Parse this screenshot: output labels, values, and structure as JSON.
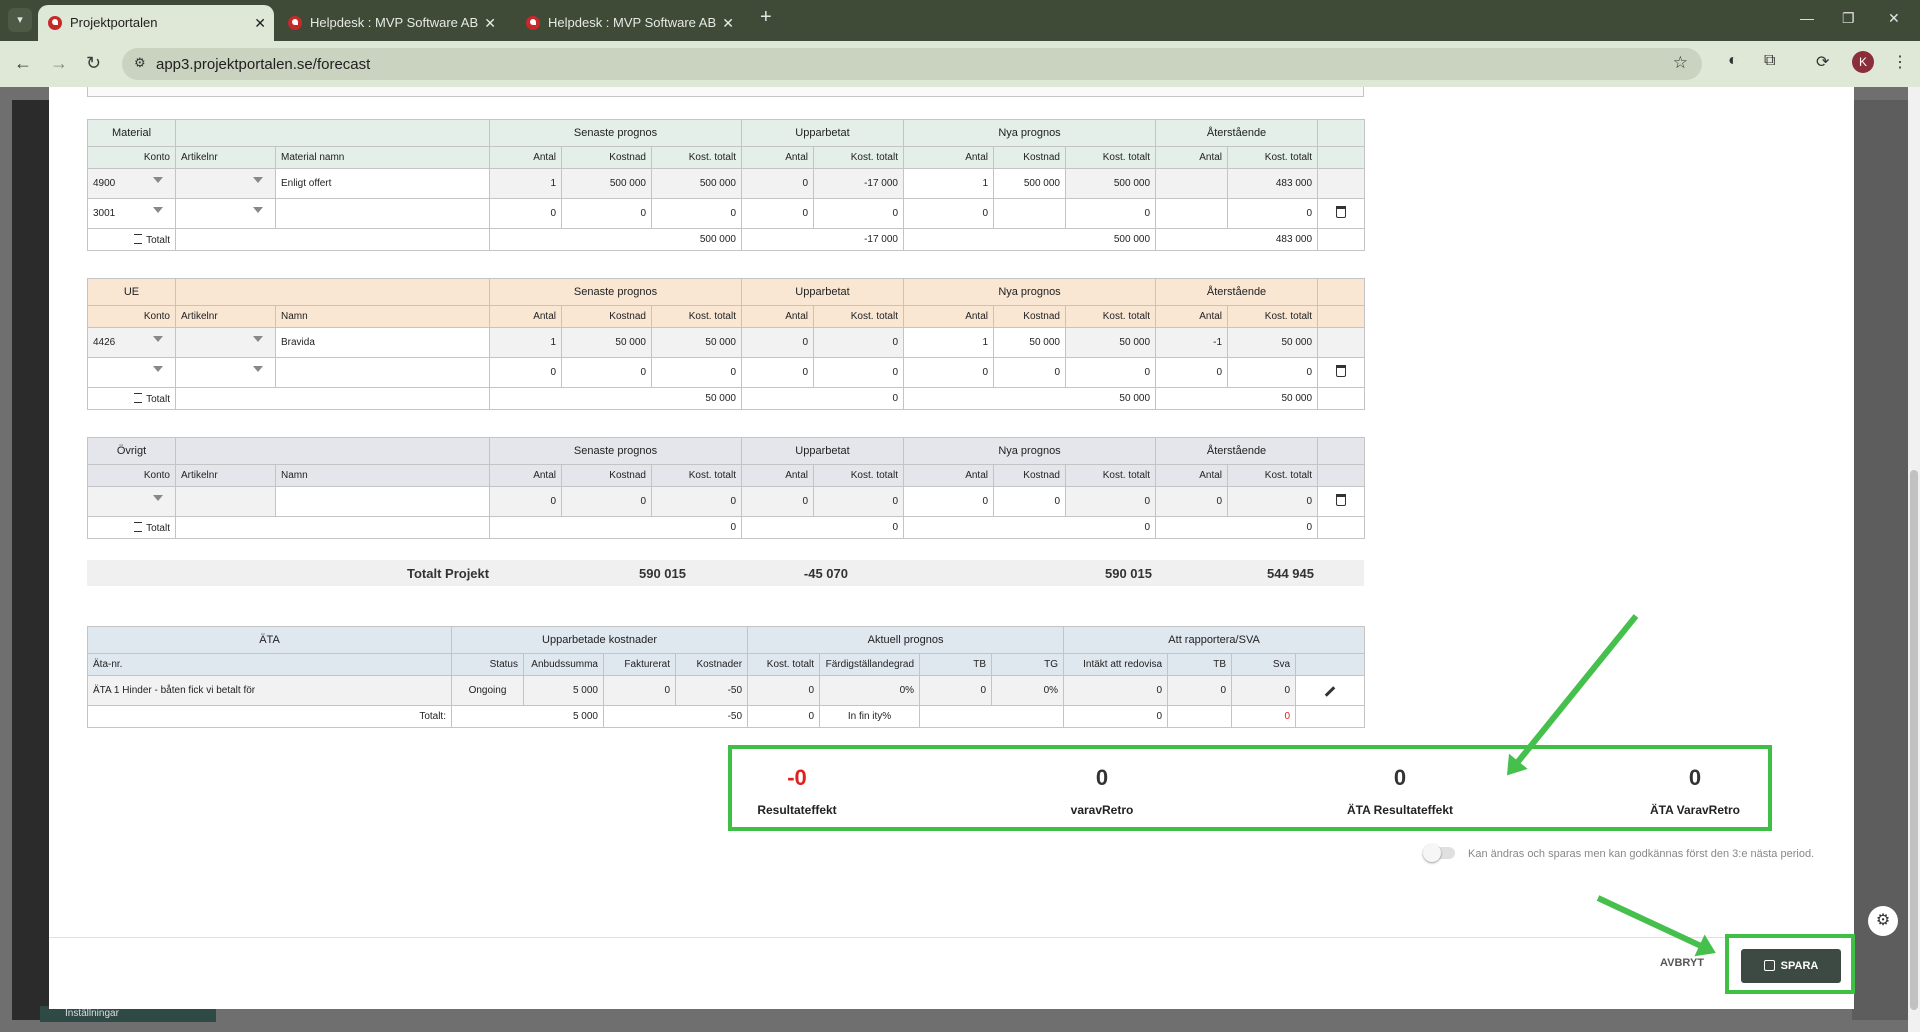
{
  "browser": {
    "tabs": [
      {
        "title": "Projektportalen"
      },
      {
        "title": "Helpdesk : MVP Software AB"
      },
      {
        "title": "Helpdesk : MVP Software AB"
      }
    ],
    "url": "app3.projektportalen.se/forecast",
    "profile_initial": "K"
  },
  "material": {
    "section": "Material",
    "group_headers": [
      "Senaste prognos",
      "Upparbetat",
      "Nya prognos",
      "Återstående"
    ],
    "col_headers": [
      "Konto",
      "Artikelnr",
      "Material namn",
      "Antal",
      "Kostnad",
      "Kost. totalt",
      "Antal",
      "Kost. totalt",
      "Antal",
      "Kostnad",
      "Kost. totalt",
      "Antal",
      "Kost. totalt"
    ],
    "rows": [
      {
        "konto": "4900",
        "artikel": "",
        "namn": "Enligt offert",
        "v": [
          "1",
          "500 000",
          "500 000",
          "0",
          "-17 000",
          "1",
          "500 000",
          "500 000",
          "",
          "483 000"
        ]
      },
      {
        "konto": "3001",
        "artikel": "",
        "namn": "",
        "v": [
          "0",
          "0",
          "0",
          "0",
          "0",
          "0",
          "",
          "0",
          "",
          "0"
        ]
      }
    ],
    "total_label": "Totalt",
    "totals": [
      "500 000",
      "-17 000",
      "500 000",
      "483 000"
    ]
  },
  "ue": {
    "section": "UE",
    "group_headers": [
      "Senaste prognos",
      "Upparbetat",
      "Nya prognos",
      "Återstående"
    ],
    "col_headers": [
      "Konto",
      "Artikelnr",
      "Namn",
      "Antal",
      "Kostnad",
      "Kost. totalt",
      "Antal",
      "Kost. totalt",
      "Antal",
      "Kostnad",
      "Kost. totalt",
      "Antal",
      "Kost. totalt"
    ],
    "rows": [
      {
        "konto": "4426",
        "artikel": "",
        "namn": "Bravida",
        "v": [
          "1",
          "50 000",
          "50 000",
          "0",
          "0",
          "1",
          "50 000",
          "50 000",
          "-1",
          "50 000"
        ]
      },
      {
        "konto": "",
        "artikel": "",
        "namn": "",
        "v": [
          "0",
          "0",
          "0",
          "0",
          "0",
          "0",
          "0",
          "0",
          "0",
          "0"
        ]
      }
    ],
    "total_label": "Totalt",
    "totals": [
      "50 000",
      "0",
      "50 000",
      "50 000"
    ]
  },
  "ovrigt": {
    "section": "Övrigt",
    "group_headers": [
      "Senaste prognos",
      "Upparbetat",
      "Nya prognos",
      "Återstående"
    ],
    "col_headers": [
      "Konto",
      "Artikelnr",
      "Namn",
      "Antal",
      "Kostnad",
      "Kost. totalt",
      "Antal",
      "Kost. totalt",
      "Antal",
      "Kostnad",
      "Kost. totalt",
      "Antal",
      "Kost. totalt"
    ],
    "rows": [
      {
        "konto": "",
        "artikel": "",
        "namn": "",
        "v": [
          "0",
          "0",
          "0",
          "0",
          "0",
          "0",
          "0",
          "0",
          "0",
          "0"
        ]
      }
    ],
    "total_label": "Totalt",
    "totals": [
      "0",
      "0",
      "0",
      "0"
    ]
  },
  "totalt_projekt": {
    "label": "Totalt Projekt",
    "values": [
      "590 015",
      "-45 070",
      "590 015",
      "544 945"
    ]
  },
  "ata": {
    "section": "ÄTA",
    "group_headers": [
      "Upparbetade kostnader",
      "Aktuell prognos",
      "Att rapportera/SVA"
    ],
    "col_headers": [
      "Äta-nr.",
      "Status",
      "Anbudssumma",
      "Fakturerat",
      "Kostnader",
      "Kost. totalt",
      "Färdigställandegrad",
      "TB",
      "TG",
      "Intäkt att redovisa",
      "TB",
      "Sva"
    ],
    "rows": [
      {
        "name": "ÄTA 1 Hinder - båten fick vi betalt för",
        "status": "Ongoing",
        "v": [
          "5 000",
          "0",
          "-50",
          "0",
          "0%",
          "0",
          "0%",
          "0",
          "0",
          "0"
        ]
      }
    ],
    "total_label": "Totalt:",
    "totals": {
      "anbud": "5 000",
      "kostnader": "-50",
      "kost_totalt": "0",
      "fardig": "In fin ity%",
      "intakt": "0",
      "sva": "0"
    }
  },
  "result": {
    "items": [
      {
        "value": "-0",
        "label": "Resultateffekt",
        "color": "#e02020"
      },
      {
        "value": "0",
        "label": "varavRetro",
        "color": "#333333"
      },
      {
        "value": "0",
        "label": "ÄTA Resultateffekt",
        "color": "#333333"
      },
      {
        "value": "0",
        "label": "ÄTA VaravRetro",
        "color": "#333333"
      }
    ]
  },
  "toggle_label": "Kan ändras och sparas men kan godkännas först den 3:e nästa period.",
  "buttons": {
    "cancel": "AVBRYT",
    "save": "SPARA"
  },
  "sidebar": {
    "settings_label": "Inställningar"
  },
  "colors": {
    "highlight": "#3fbf46",
    "save_bg": "#3d4a44",
    "negative": "#e02020"
  }
}
